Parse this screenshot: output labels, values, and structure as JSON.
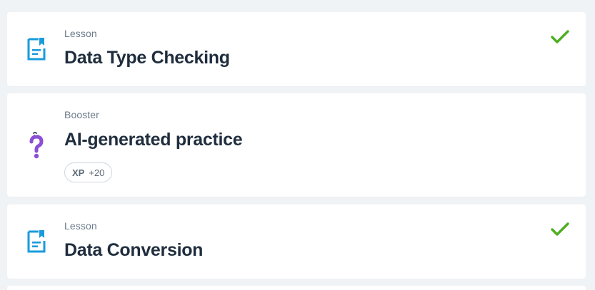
{
  "items": [
    {
      "type_label": "Lesson",
      "title": "Data Type Checking",
      "icon": "lesson-document-icon",
      "completed": true
    },
    {
      "type_label": "Booster",
      "title": "AI-generated practice",
      "icon": "question-mark-icon",
      "completed": false,
      "xp_label": "XP",
      "xp_value": "+20"
    },
    {
      "type_label": "Lesson",
      "title": "Data Conversion",
      "icon": "lesson-document-icon",
      "completed": true
    }
  ],
  "colors": {
    "background": "#f0f3f6",
    "card": "#ffffff",
    "lesson_icon": "#1a9bdb",
    "booster_icon": "#8b4fd6",
    "check": "#4caf1e",
    "title": "#1f2d3d",
    "type_label": "#6b7a8c"
  }
}
